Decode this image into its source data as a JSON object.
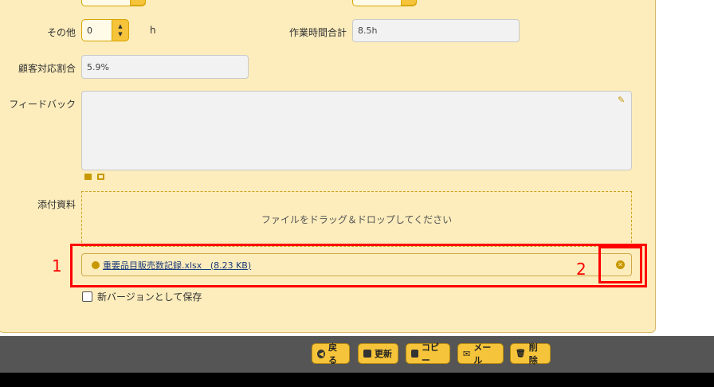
{
  "form": {
    "other_label": "その他",
    "other_value": "0",
    "other_unit": "h",
    "total_label": "作業時間合計",
    "total_value": "8.5h",
    "ratio_label": "顧客対応割合",
    "ratio_value": "5.9%",
    "feedback_label": "フィードバック",
    "feedback_value": ""
  },
  "attachment": {
    "label": "添付資料",
    "dropzone_text": "ファイルをドラッグ＆ドロップしてください",
    "file_name": "重要品目販売数記録.xlsx",
    "file_size": "(8.23 KB)",
    "new_version_label": "新バージョンとして保存"
  },
  "annotations": {
    "marker_1": "1",
    "marker_2": "2",
    "color": "#ff0000"
  },
  "footer": {
    "back": "戻る",
    "update": "更新",
    "copy": "コピー",
    "mail": "メール",
    "delete": "削除"
  },
  "colors": {
    "panel_bg": "#fdedbc",
    "accent": "#f6c43a",
    "footer_bg": "#555555"
  }
}
